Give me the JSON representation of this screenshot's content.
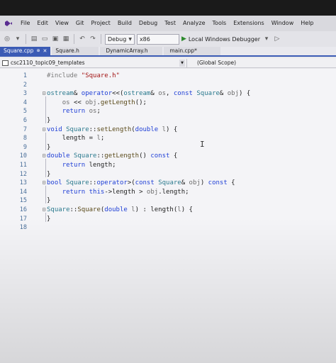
{
  "menubar": {
    "items": [
      "File",
      "Edit",
      "View",
      "Git",
      "Project",
      "Build",
      "Debug",
      "Test",
      "Analyze",
      "Tools",
      "Extensions",
      "Window",
      "Help"
    ]
  },
  "toolbar": {
    "config": "Debug",
    "platform": "x86",
    "run_label": "Local Windows Debugger"
  },
  "tabs": [
    {
      "label": "Square.cpp",
      "active": true
    },
    {
      "label": "Square.h",
      "active": false
    },
    {
      "label": "DynamicArray.h",
      "active": false
    },
    {
      "label": "main.cpp*",
      "active": false
    }
  ],
  "navbar": {
    "project": "csc2110_topic09_templates",
    "scope": "(Global Scope)"
  },
  "editor": {
    "lines": [
      {
        "n": "1",
        "html": "<span class=\"pp\">#include</span> <span class=\"str\">\"Square.h\"</span>"
      },
      {
        "n": "2",
        "html": ""
      },
      {
        "n": "3",
        "fold": "⊟",
        "html": "<span class=\"ty\">ostream</span>&amp; <span class=\"kw\">operator</span>&lt;&lt;(<span class=\"ty\">ostream</span>&amp; <span class=\"pm\">os</span>, <span class=\"kw\">const</span> <span class=\"ty\">Square</span>&amp; <span class=\"pm\">obj</span>) {"
      },
      {
        "n": "4",
        "html": "    <span class=\"pm\">os</span> &lt;&lt; <span class=\"pm\">obj</span>.<span class=\"fn\">getLength</span>();"
      },
      {
        "n": "5",
        "html": "    <span class=\"kw\">return</span> <span class=\"pm\">os</span>;"
      },
      {
        "n": "6",
        "html": "}"
      },
      {
        "n": "7",
        "fold": "⊟",
        "html": "<span class=\"kw\">void</span> <span class=\"ty\">Square</span>::<span class=\"fn\">setLength</span>(<span class=\"kw\">double</span> <span class=\"pm\">l</span>) {"
      },
      {
        "n": "8",
        "html": "    length = <span class=\"pm\">l</span>;"
      },
      {
        "n": "9",
        "html": "}"
      },
      {
        "n": "10",
        "fold": "⊟",
        "html": "<span class=\"kw\">double</span> <span class=\"ty\">Square</span>::<span class=\"fn\">getLength</span>() <span class=\"kw\">const</span> {"
      },
      {
        "n": "11",
        "html": "    <span class=\"kw\">return</span> length;"
      },
      {
        "n": "12",
        "html": "}"
      },
      {
        "n": "13",
        "fold": "⊟",
        "html": "<span class=\"kw\">bool</span> <span class=\"ty\">Square</span>::<span class=\"kw\">operator</span>&gt;(<span class=\"kw\">const</span> <span class=\"ty\">Square</span>&amp; <span class=\"pm\">obj</span>) <span class=\"kw\">const</span> {"
      },
      {
        "n": "14",
        "html": "    <span class=\"kw\">return</span> <span class=\"kw\">this</span>-&gt;length &gt; <span class=\"pm\">obj</span>.length;"
      },
      {
        "n": "15",
        "html": "}"
      },
      {
        "n": "16",
        "fold": "⊟",
        "html": "<span class=\"ty\">Square</span>::<span class=\"fn\">Square</span>(<span class=\"kw\">double</span> <span class=\"pm\">l</span>) : length(<span class=\"pm\">l</span>) {"
      },
      {
        "n": "17",
        "html": "}"
      },
      {
        "n": "18",
        "html": ""
      }
    ]
  },
  "icons": {
    "logo": "visual-studio-logo-icon",
    "play": "play-icon"
  },
  "colors": {
    "accent": "#3b5bb5",
    "keyword": "#1f3fd6",
    "type": "#2b7a8e",
    "string": "#a31515"
  }
}
